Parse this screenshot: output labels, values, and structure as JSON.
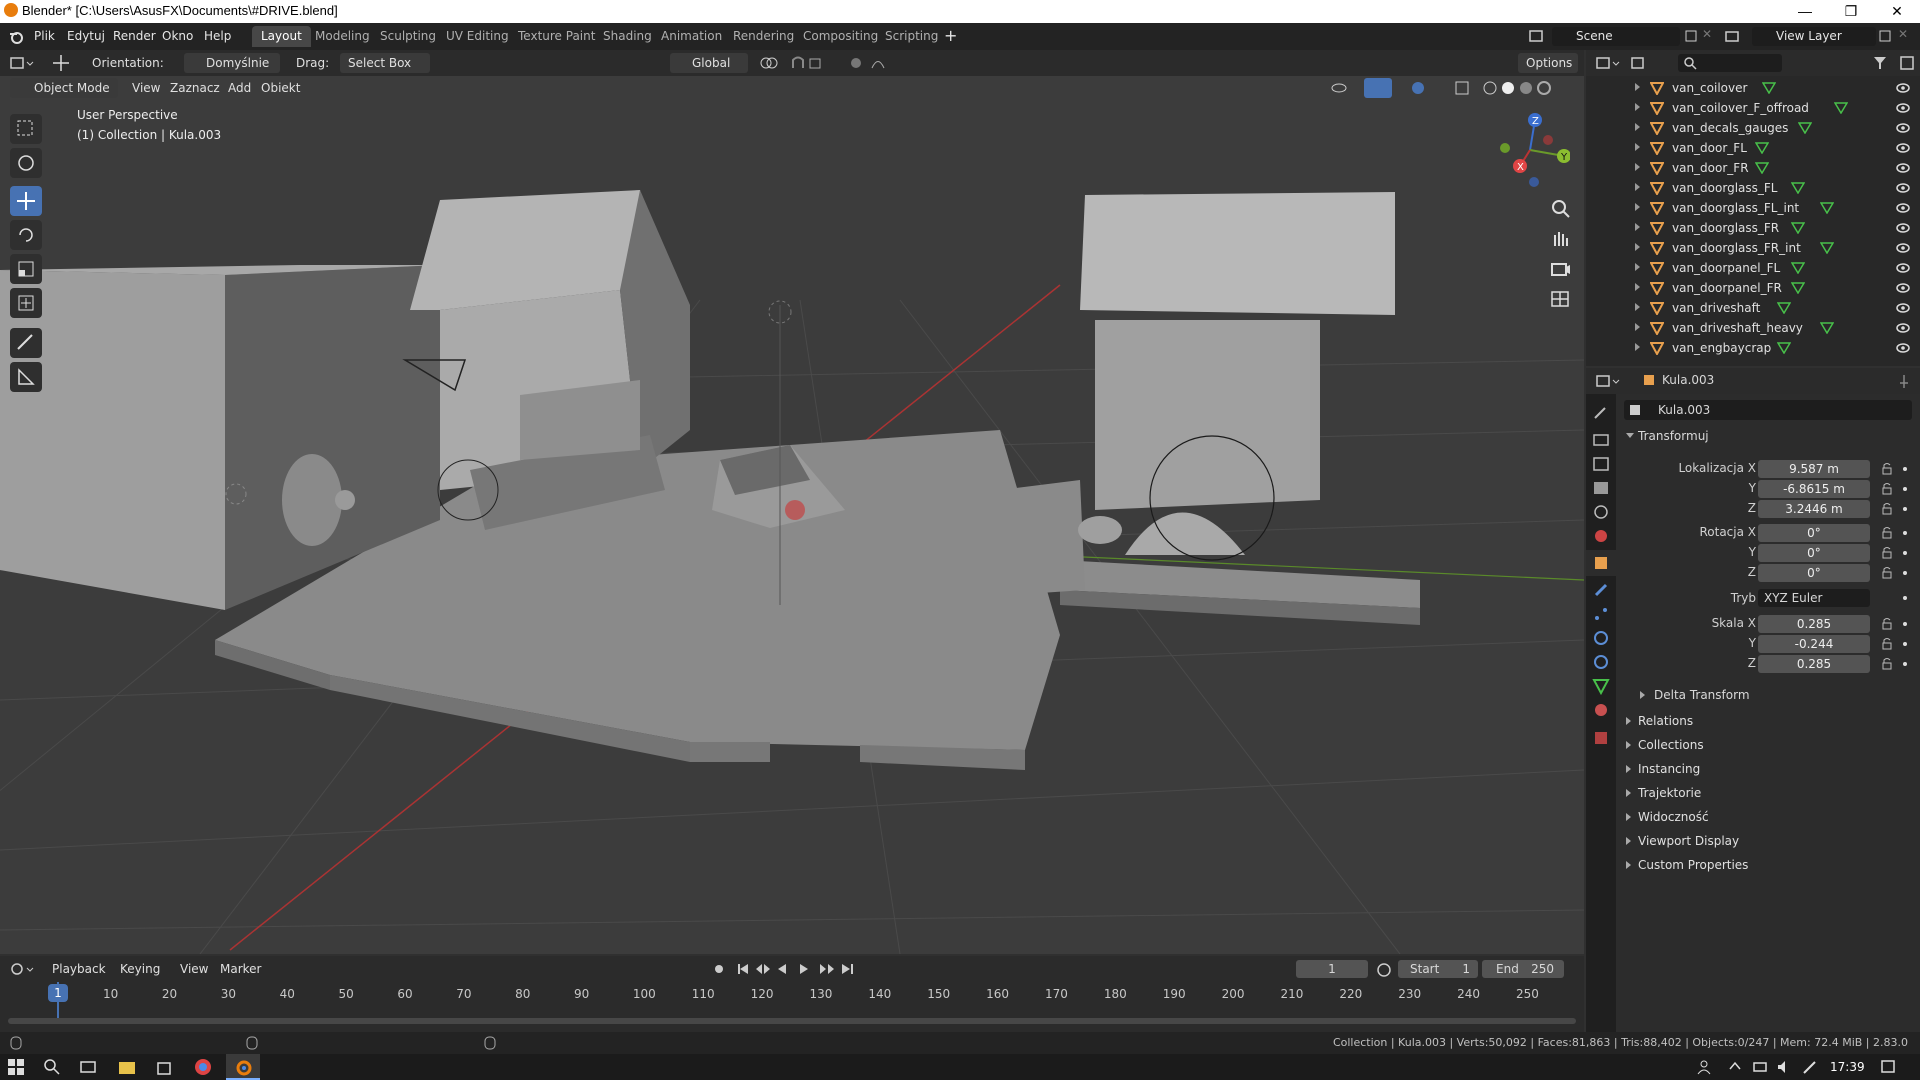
{
  "window": {
    "title": "Blender* [C:\\Users\\AsusFX\\Documents\\#DRIVE.blend]"
  },
  "menu": [
    "Plik",
    "Edytuj",
    "Render",
    "Okno",
    "Help"
  ],
  "workspaces": [
    "Layout",
    "Modeling",
    "Sculpting",
    "UV Editing",
    "Texture Paint",
    "Shading",
    "Animation",
    "Rendering",
    "Compositing",
    "Scripting"
  ],
  "workspace_active": "Layout",
  "scene": {
    "name": "Scene",
    "view_layer": "View Layer"
  },
  "viewport": {
    "orientation_label": "Orientation:",
    "orientation_value": "Domyślnie",
    "drag_label": "Drag:",
    "drag_value": "Select Box",
    "transform_orientation": "Global",
    "options": "Options",
    "mode": "Object Mode",
    "header_menus": [
      "View",
      "Zaznacz",
      "Add",
      "Obiekt"
    ],
    "info_line1": "User Perspective",
    "info_line2": "(1) Collection | Kula.003",
    "gizmo_axes": [
      "X",
      "Y",
      "Z"
    ]
  },
  "outliner": {
    "items": [
      "van_coilover",
      "van_coilover_F_offroad",
      "van_decals_gauges",
      "van_door_FL",
      "van_door_FR",
      "van_doorglass_FL",
      "van_doorglass_FL_int",
      "van_doorglass_FR",
      "van_doorglass_FR_int",
      "van_doorpanel_FL",
      "van_doorpanel_FR",
      "van_driveshaft",
      "van_driveshaft_heavy",
      "van_engbaycrap"
    ]
  },
  "properties": {
    "object_name": "Kula.003",
    "datablock_name": "Kula.003",
    "transform_header": "Transformuj",
    "location_label": "Lokalizacja X",
    "location": [
      "9.587 m",
      "-6.8615 m",
      "3.2446 m"
    ],
    "rotation_label": "Rotacja X",
    "rotation": [
      "0°",
      "0°",
      "0°"
    ],
    "mode_label": "Tryb",
    "rotation_mode": "XYZ Euler",
    "scale_label": "Skala X",
    "scale": [
      "0.285",
      "-0.244",
      "0.285"
    ],
    "axis_y": "Y",
    "axis_z": "Z",
    "delta_transform": "Delta Transform",
    "panels": [
      "Relations",
      "Collections",
      "Instancing",
      "Trajektorie",
      "Widoczność",
      "Viewport Display",
      "Custom Properties"
    ]
  },
  "timeline": {
    "menus": [
      "Playback",
      "Keying",
      "View",
      "Marker"
    ],
    "current_frame": "1",
    "start_label": "Start",
    "start": "1",
    "end_label": "End",
    "end": "250",
    "ruler": [
      "1",
      "10",
      "20",
      "30",
      "40",
      "50",
      "60",
      "70",
      "80",
      "90",
      "100",
      "110",
      "120",
      "130",
      "140",
      "150",
      "160",
      "170",
      "180",
      "190",
      "200",
      "210",
      "220",
      "230",
      "240",
      "250"
    ]
  },
  "status": {
    "text": "Collection | Kula.003 | Verts:50,092 | Faces:81,863 | Tris:88,402 | Objects:0/247 | Mem: 72.4 MiB | 2.83.0"
  },
  "taskbar": {
    "clock": "17:39"
  },
  "colors": {
    "accent": "#4772b3",
    "orange": "#e87d0d",
    "object_icon": "#e8a04e",
    "mesh_icon": "#48c04a"
  }
}
